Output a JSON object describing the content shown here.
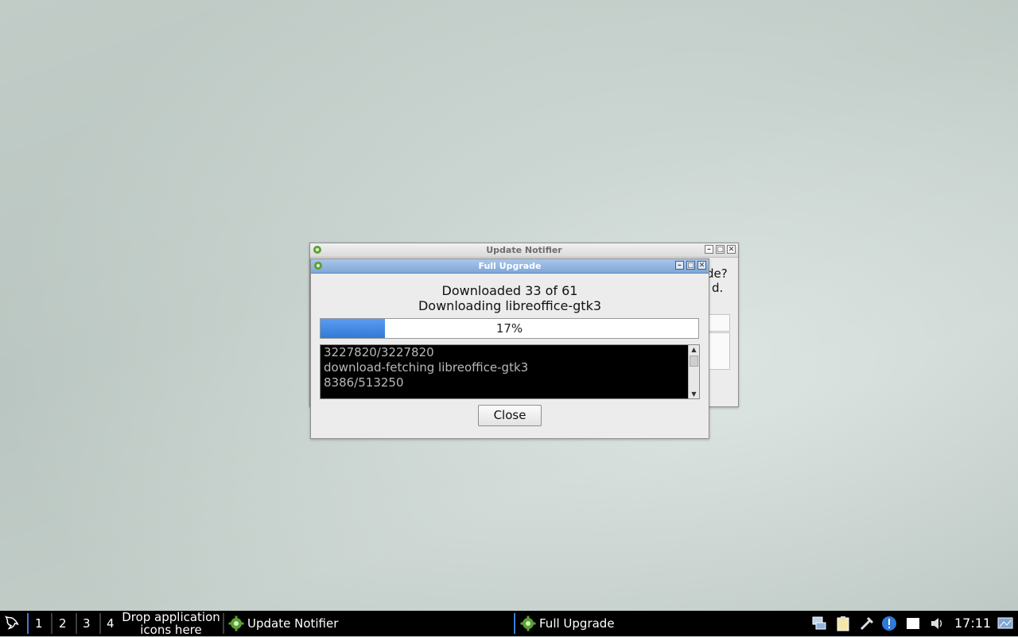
{
  "background_window": {
    "title": "Update Notifier",
    "partial_text_line1": "de?",
    "partial_text_line2": "d."
  },
  "dialog": {
    "title": "Full Upgrade",
    "downloaded_line": "Downloaded 33 of 61",
    "downloading_line": "Downloading libreoffice-gtk3",
    "progress": {
      "percent_label": "17%",
      "fraction": 0.17
    },
    "log_lines": [
      "3227820/3227820",
      "download-fetching libreoffice-gtk3",
      "8386/513250"
    ],
    "close_label": "Close"
  },
  "taskbar": {
    "workspaces": [
      "1",
      "2",
      "3",
      "4"
    ],
    "drop_hint_line1": "Drop application",
    "drop_hint_line2": "icons here",
    "tasks": [
      {
        "label": "Update Notifier",
        "icon": "gear-icon"
      },
      {
        "label": "Full Upgrade",
        "icon": "gear-icon"
      }
    ],
    "tray_icons": [
      "network-icon",
      "clipboard-icon",
      "tools-icon",
      "info-icon",
      "notes-icon",
      "volume-icon",
      "desktop-icon"
    ],
    "clock": "17:11"
  },
  "colors": {
    "accent": "#3e7bd6",
    "active_titlebar": "#7fa6d6",
    "progress_fill": "#2f7ad8"
  }
}
